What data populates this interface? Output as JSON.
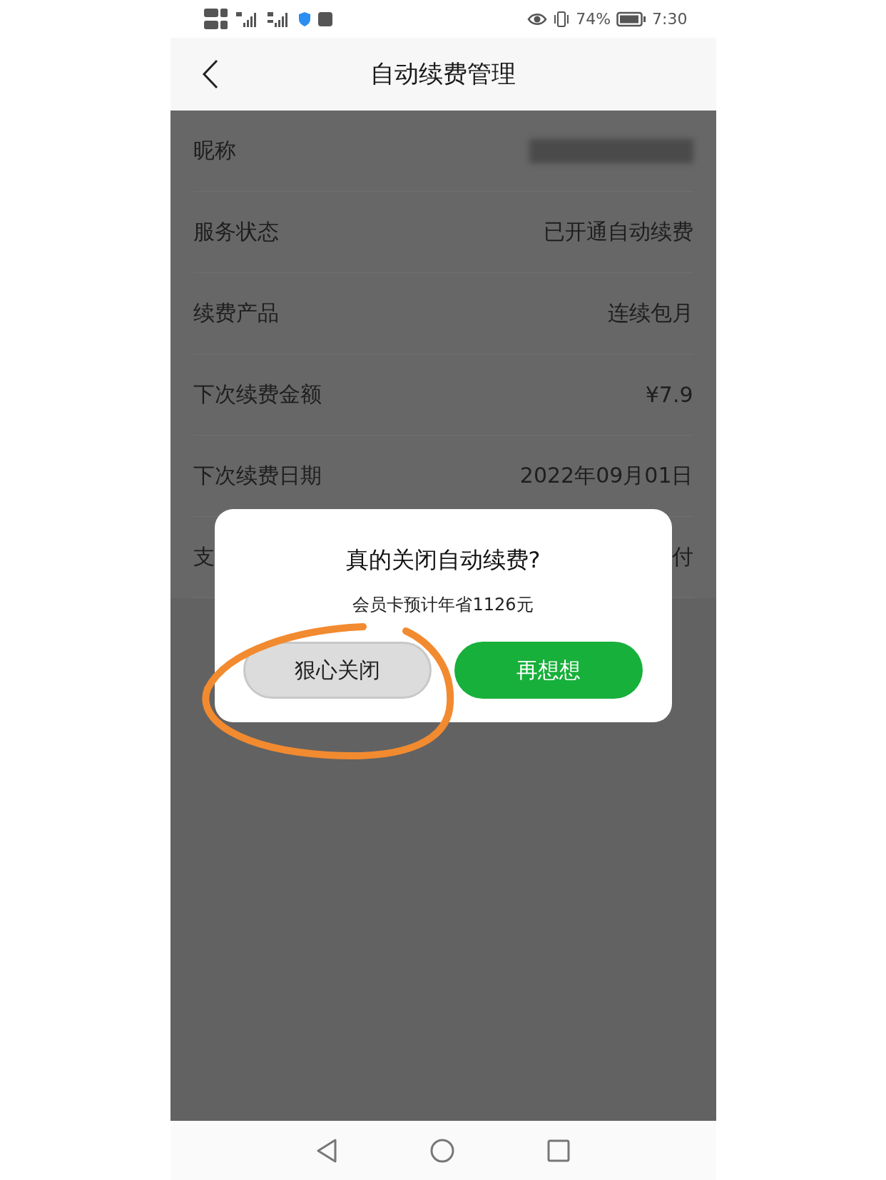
{
  "status_bar": {
    "battery": "74%",
    "time": "7:30"
  },
  "nav": {
    "title": "自动续费管理"
  },
  "rows": [
    {
      "label": "昵称",
      "kind": "blurred"
    },
    {
      "label": "服务状态",
      "value": "已开通自动续费",
      "kind": "text"
    },
    {
      "label": "续费产品",
      "value": "连续包月",
      "kind": "text"
    },
    {
      "label": "下次续费金额",
      "value": "¥7.9",
      "kind": "text"
    },
    {
      "label": "下次续费日期",
      "value": "2022年09月01日",
      "kind": "text"
    },
    {
      "label": "支",
      "value": "付",
      "kind": "text"
    }
  ],
  "dialog": {
    "title": "真的关闭自动续费?",
    "message": "会员卡预计年省1126元",
    "buttons": [
      {
        "label": "狠心关闭",
        "kind": "secondary"
      },
      {
        "label": "再想想",
        "kind": "primary"
      }
    ]
  }
}
